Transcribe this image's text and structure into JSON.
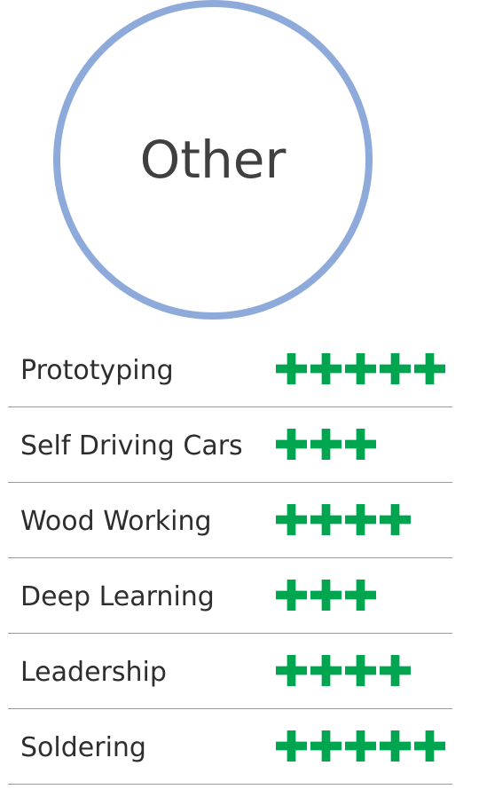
{
  "title": "Other",
  "colors": {
    "circle_border": "#8eaadb",
    "plus": "#00a550",
    "text": "#2e2e2e",
    "divider": "#9a9a9a"
  },
  "rating_icon": "plus-icon",
  "skills": [
    {
      "label": "Prototyping",
      "rating": 5
    },
    {
      "label": "Self Driving Cars",
      "rating": 3
    },
    {
      "label": "Wood Working",
      "rating": 4
    },
    {
      "label": "Deep Learning",
      "rating": 3
    },
    {
      "label": "Leadership",
      "rating": 4
    },
    {
      "label": "Soldering",
      "rating": 5
    }
  ]
}
